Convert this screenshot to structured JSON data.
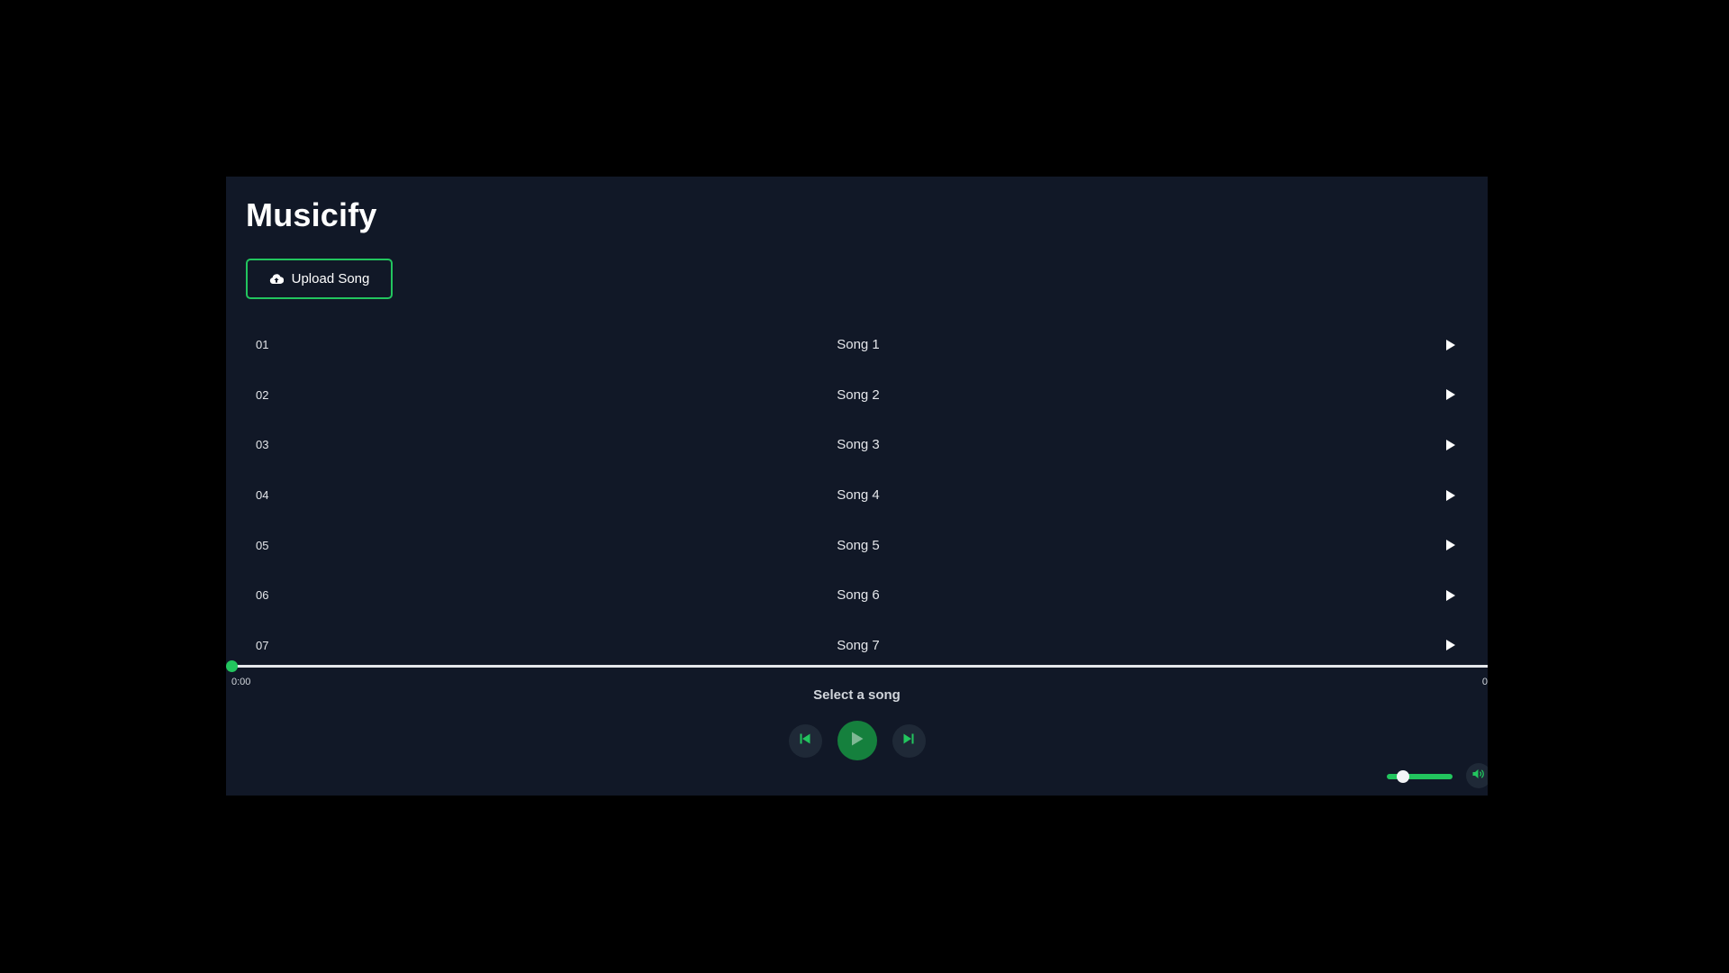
{
  "app": {
    "title": "Musicify"
  },
  "upload": {
    "label": "Upload Song",
    "icon": "cloud-upload-icon"
  },
  "songs": [
    {
      "number": "01",
      "title": "Song 1"
    },
    {
      "number": "02",
      "title": "Song 2"
    },
    {
      "number": "03",
      "title": "Song 3"
    },
    {
      "number": "04",
      "title": "Song 4"
    },
    {
      "number": "05",
      "title": "Song 5"
    },
    {
      "number": "06",
      "title": "Song 6"
    },
    {
      "number": "07",
      "title": "Song 7"
    }
  ],
  "player": {
    "current_time": "0:00",
    "total_time": "0",
    "progress": 0,
    "now_playing": "Select a song",
    "volume": 0.25,
    "icons": {
      "previous": "skip-back-icon",
      "play": "play-icon",
      "next": "skip-forward-icon",
      "volume": "volume-icon"
    }
  },
  "colors": {
    "page_background": "#000000",
    "app_background": "#111827",
    "accent": "#22c55e",
    "play_button": "#15803d",
    "control_background": "#1f2937",
    "text": "#ffffff",
    "muted_text": "#d1d5db"
  }
}
